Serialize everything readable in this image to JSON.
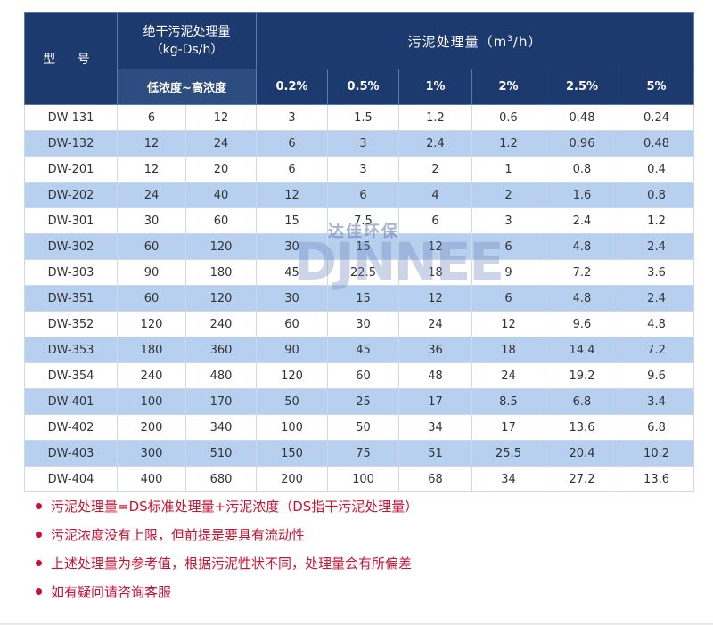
{
  "header": {
    "model": "型 号",
    "dry_line1": "绝干污泥处理量",
    "dry_line2": "（kg-Ds/h）",
    "sludge_pre": "污泥处理量（m",
    "sludge_sup": "3",
    "sludge_post": "/h）",
    "conc_range": "低浓度~高浓度",
    "concentrations": [
      "0.2%",
      "0.5%",
      "1%",
      "2%",
      "2.5%",
      "5%"
    ]
  },
  "rows": [
    [
      "DW-131",
      "6",
      "12",
      "3",
      "1.5",
      "1.2",
      "0.6",
      "0.48",
      "0.24"
    ],
    [
      "DW-132",
      "12",
      "24",
      "6",
      "3",
      "2.4",
      "1.2",
      "0.96",
      "0.48"
    ],
    [
      "DW-201",
      "12",
      "20",
      "6",
      "3",
      "2",
      "1",
      "0.8",
      "0.4"
    ],
    [
      "DW-202",
      "24",
      "40",
      "12",
      "6",
      "4",
      "2",
      "1.6",
      "0.8"
    ],
    [
      "DW-301",
      "30",
      "60",
      "15",
      "7.5",
      "6",
      "3",
      "2.4",
      "1.2"
    ],
    [
      "DW-302",
      "60",
      "120",
      "30",
      "15",
      "12",
      "6",
      "4.8",
      "2.4"
    ],
    [
      "DW-303",
      "90",
      "180",
      "45",
      "22.5",
      "18",
      "9",
      "7.2",
      "3.6"
    ],
    [
      "DW-351",
      "60",
      "120",
      "30",
      "15",
      "12",
      "6",
      "4.8",
      "2.4"
    ],
    [
      "DW-352",
      "120",
      "240",
      "60",
      "30",
      "24",
      "12",
      "9.6",
      "4.8"
    ],
    [
      "DW-353",
      "180",
      "360",
      "90",
      "45",
      "36",
      "18",
      "14.4",
      "7.2"
    ],
    [
      "DW-354",
      "240",
      "480",
      "120",
      "60",
      "48",
      "24",
      "19.2",
      "9.6"
    ],
    [
      "DW-401",
      "100",
      "170",
      "50",
      "25",
      "17",
      "8.5",
      "6.8",
      "3.4"
    ],
    [
      "DW-402",
      "200",
      "340",
      "100",
      "50",
      "34",
      "17",
      "13.6",
      "6.8"
    ],
    [
      "DW-403",
      "300",
      "510",
      "150",
      "75",
      "51",
      "25.5",
      "20.4",
      "10.2"
    ],
    [
      "DW-404",
      "400",
      "680",
      "200",
      "100",
      "68",
      "34",
      "27.2",
      "13.6"
    ]
  ],
  "watermark": {
    "cn": "达佳环保",
    "en": "DJNNEE"
  },
  "notes": [
    "污泥处理量=DS标准处理量+污泥浓度（DS指干污泥处理量）",
    "污泥浓度没有上限，但前提是要具有流动性",
    "上述处理量为参考值，根据污泥性状不同，处理量会有所偏差",
    "如有疑问请咨询客服"
  ],
  "colors": {
    "header_bg": "#1d3a6f",
    "row_alt": "#b8d0f0",
    "note_red": "#cc1133"
  }
}
